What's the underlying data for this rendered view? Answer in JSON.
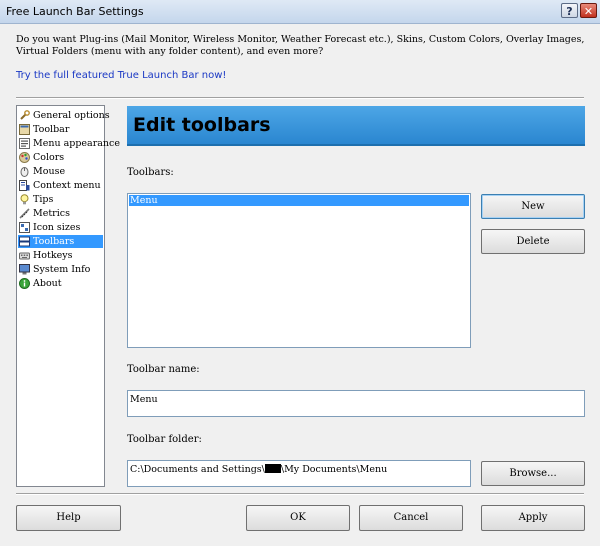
{
  "window": {
    "title": "Free Launch Bar Settings",
    "help_glyph": "?",
    "close_glyph": "✕"
  },
  "promo": {
    "text": "Do you want Plug-ins (Mail Monitor, Wireless Monitor, Weather Forecast etc.), Skins, Custom Colors, Overlay Images, Virtual Folders (menu with any folder content), and even more?",
    "link": "Try the full featured True Launch Bar now!"
  },
  "sidebar": {
    "items": [
      {
        "label": "General options",
        "icon": "wrench-icon"
      },
      {
        "label": "Toolbar",
        "icon": "toolbar-icon"
      },
      {
        "label": "Menu appearance",
        "icon": "menu-icon"
      },
      {
        "label": "Colors",
        "icon": "palette-icon"
      },
      {
        "label": "Mouse",
        "icon": "mouse-icon"
      },
      {
        "label": "Context menu",
        "icon": "context-menu-icon"
      },
      {
        "label": "Tips",
        "icon": "lightbulb-icon"
      },
      {
        "label": "Metrics",
        "icon": "metrics-icon"
      },
      {
        "label": "Icon sizes",
        "icon": "icon-sizes-icon"
      },
      {
        "label": "Toolbars",
        "icon": "toolbars-icon",
        "selected": true
      },
      {
        "label": "Hotkeys",
        "icon": "keyboard-icon"
      },
      {
        "label": "System Info",
        "icon": "monitor-icon"
      },
      {
        "label": "About",
        "icon": "info-icon"
      }
    ]
  },
  "main": {
    "heading": "Edit toolbars",
    "toolbars_label": "Toolbars:",
    "toolbars_list": [
      "Menu"
    ],
    "new_button": "New",
    "delete_button": "Delete",
    "toolbar_name_label": "Toolbar name:",
    "toolbar_name_value": "Menu",
    "toolbar_folder_label": "Toolbar folder:",
    "toolbar_folder_prefix": "C:\\Documents and Settings\\",
    "toolbar_folder_suffix": "\\My Documents\\Menu",
    "browse_button": "Browse..."
  },
  "footer": {
    "help": "Help",
    "ok": "OK",
    "cancel": "Cancel",
    "apply": "Apply"
  },
  "colors": {
    "accent": "#3399ff",
    "banner": "#2a86d0",
    "link": "#1a38c4"
  }
}
